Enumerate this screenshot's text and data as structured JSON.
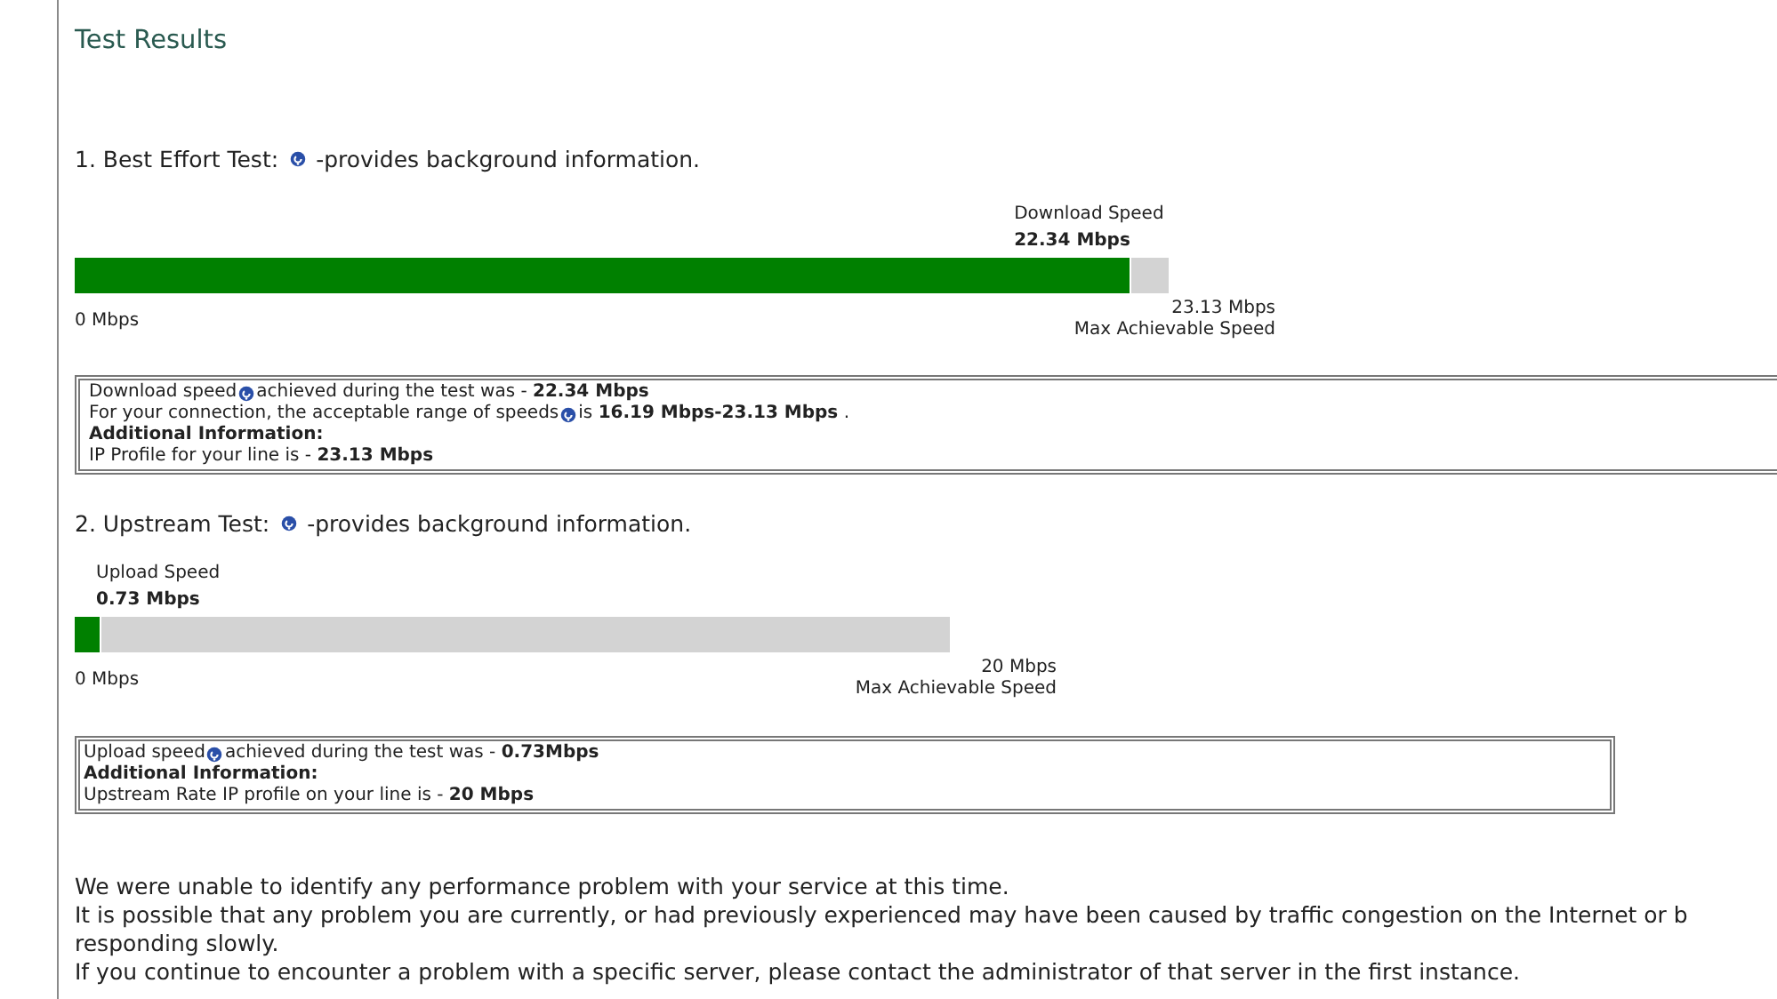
{
  "title": "Test Results",
  "tests": [
    {
      "kind": "download",
      "heading": "1. Best Effort Test:",
      "heading_note": "-provides background information.",
      "speed_label": "Download Speed",
      "speed": "22.34 Mbps",
      "level": 0.966,
      "min_label": "0 Mbps",
      "max_value": "23.13 Mbps",
      "max_label": "Max Achievable Speed",
      "info": [
        {
          "kind": "help",
          "lead": "Download speed",
          "text": "achieved during the test was - **22.34 Mbps**"
        },
        {
          "kind": "help",
          "lead": "For your connection, the acceptable range of speeds",
          "text": "is **16.19 Mbps-23.13 Mbps** ."
        },
        {
          "kind": "heading",
          "text": "Additional Information:"
        },
        {
          "kind": "plain",
          "text": "IP Profile for your line is - **23.13 Mbps**"
        }
      ]
    },
    {
      "kind": "upload",
      "heading": "2. Upstream Test:",
      "heading_note": "-provides background information.",
      "speed_label": "Upload Speed",
      "speed": "0.73 Mbps",
      "level": 0.03,
      "min_label": "0 Mbps",
      "max_value": "20 Mbps",
      "max_label": "Max Achievable Speed",
      "info": [
        {
          "kind": "help",
          "lead": "Upload speed",
          "text": " achieved during the test was - **0.73Mbps**"
        },
        {
          "kind": "heading",
          "text": "Additional Information:"
        },
        {
          "kind": "plain",
          "text": "Upstream Rate IP profile on your line is - **20 Mbps**"
        }
      ]
    }
  ],
  "summary": [
    "We were unable to identify any performance problem with your service at this time.",
    "It is possible that any problem you are currently, or had previously experienced may have been caused by traffic congestion on the Internet or b",
    "responding slowly.",
    "If you continue to encounter a problem with a specific server, please contact the administrator of that server in the first instance."
  ]
}
